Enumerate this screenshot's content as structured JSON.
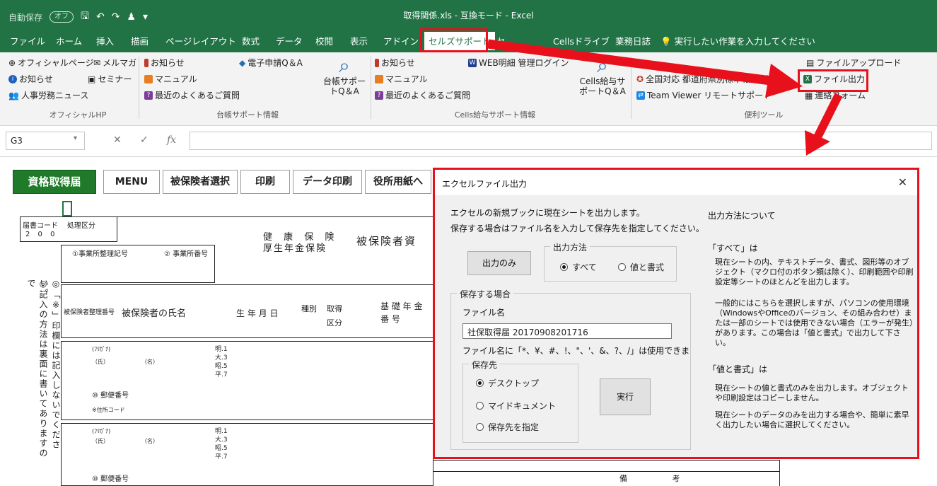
{
  "titlebar": {
    "autosave": "自動保存",
    "toggle": "オフ",
    "title": "取得関係.xls - 互換モード - Excel"
  },
  "menu": {
    "tabs": [
      "ファイル",
      "ホーム",
      "挿入",
      "描画",
      "ページレイアウト",
      "数式",
      "データ",
      "校閲",
      "表示",
      "アドイン",
      "セルズサポート",
      "セ",
      "Cellsドライブ",
      "業務日誌"
    ],
    "tell_me": "実行したい作業を入力してください"
  },
  "ribbon": {
    "official": [
      "オフィシャルページ",
      "お知らせ",
      "人事労務ニュース"
    ],
    "official2": [
      "メルマガ",
      "セミナー"
    ],
    "official_group": "オフィシャルHP",
    "daicho": [
      "お知らせ",
      "マニュアル",
      "最近のよくあるご質問"
    ],
    "daicho_qa": "電子申請Q＆A",
    "daicho_big": "台帳サポートQ＆A",
    "daicho_group": "台帳サポート情報",
    "cells": [
      "お知らせ",
      "マニュアル",
      "最近のよくあるご質問"
    ],
    "cells_web": "WEB明細 管理ログイン",
    "cells_big": "Cells給与サポートQ＆A",
    "cells_group": "Cells給与サポート情報",
    "tools": [
      "全国対応 都道府県別標準報",
      "等級表",
      "Team Viewer リモートサポート"
    ],
    "tools_right": [
      "ファイルアップロード",
      "ファイル出力",
      "連絡フォーム"
    ],
    "tools_group": "便利ツール"
  },
  "formula": {
    "namebox": "G3",
    "fx": "fx"
  },
  "sheet": {
    "buttons": [
      "資格取得届",
      "MENU",
      "被保険者選択",
      "印刷",
      "データ印刷",
      "役所用紙へ"
    ],
    "labels": {
      "code": "届書コード",
      "kubun": "処理区分",
      "code_val": "2 0 0",
      "jigyo": "①事業所整理記号",
      "jigyo_no": "② 事業所番号",
      "kenko": "健 康 保 険",
      "kosei": "厚生年金保険",
      "hihoken": "被保険者資",
      "name_col": "被保険者の氏名",
      "birth": "生 年 月 日",
      "shubetsu": "種別",
      "shutoku": "取得",
      "kubun2": "区分",
      "kiso": "基 礎 年 金",
      "bango": "番 号",
      "seiri": "被保険者整理番号",
      "yubin": "⑩ 郵便番号",
      "jusho": "※住所コード",
      "kanji1": "（氏）",
      "kanji2": "（名）",
      "furi": "(ﾌﾘｶﾞﾅ)",
      "era": "明.1 大.3 昭.5 平.7",
      "notice": "◎記入の方法は裏面に書いてありますので",
      "notice2": "◎「※」印欄には記入しないでください。",
      "biko": "備 考"
    }
  },
  "dialog": {
    "title": "エクセルファイル出力",
    "line1": "エクセルの新規ブックに現在シートを出力します。",
    "line2": "保存する場合はファイル名を入力して保存先を指定してください。",
    "output_only": "出力のみ",
    "method_label": "出力方法",
    "method_all": "すべて",
    "method_values": "値と書式",
    "save_label": "保存する場合",
    "filename_label": "ファイル名",
    "filename_value": "社保取得届 20170908201716",
    "warning": "ファイル名に「*、¥、#、!、\"、'、&、?、/」は使用できま",
    "dest_label": "保存先",
    "dest_desktop": "デスクトップ",
    "dest_mydoc": "マイドキュメント",
    "dest_custom": "保存先を指定",
    "run": "実行",
    "about": "出力方法について",
    "all_title": "「すべて」は",
    "all_desc": "現在シートの内、テキストデータ、書式、図形等のオブジェクト（マクロ付のボタン類は除く）、印刷範囲や印刷設定等シートのほとんどを出力します。",
    "all_desc2": "一般的にはこちらを選択しますが、パソコンの使用環境（WindowsやOfficeのバージョン、その組み合わせ）または一部のシートでは使用できない場合（エラーが発生）があります。この場合は「値と書式」で出力して下さい。",
    "val_title": "「値と書式」は",
    "val_desc": "現在シートの値と書式のみを出力します。オブジェクトや印刷設定はコピーしません。",
    "val_desc2": "現在シートのデータのみを出力する場合や、簡単に素早く出力したい場合に選択してください。"
  },
  "colors": {
    "excel_green": "#217346",
    "highlight_red": "#e8111b"
  }
}
